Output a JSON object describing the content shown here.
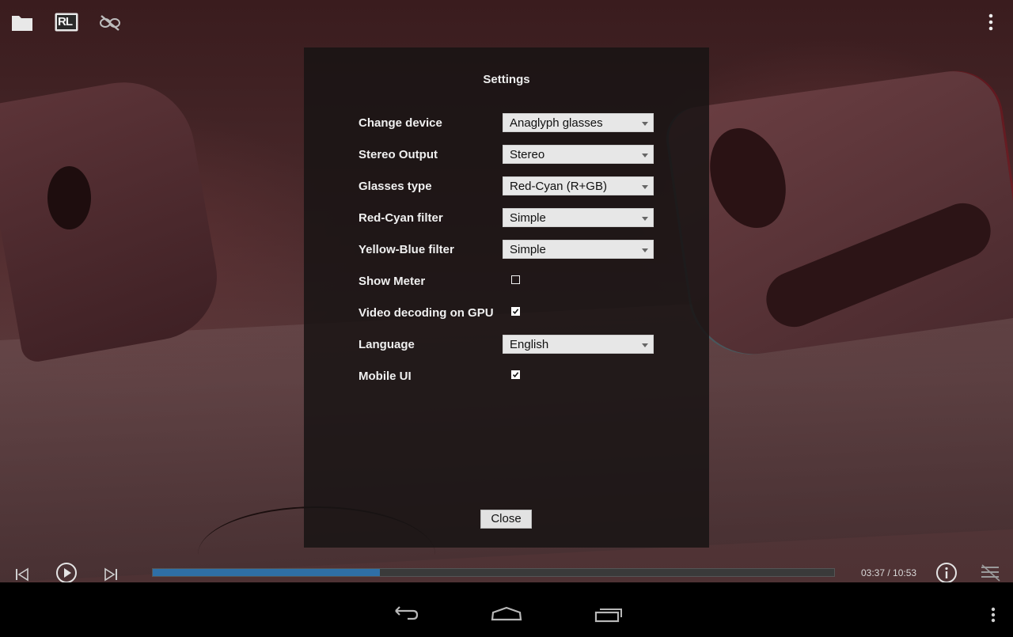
{
  "dialog": {
    "title": "Settings",
    "rows": [
      {
        "label": "Change device",
        "control": "select",
        "value": "Anaglyph glasses"
      },
      {
        "label": "Stereo Output",
        "control": "select",
        "value": "Stereo"
      },
      {
        "label": "Glasses type",
        "control": "select",
        "value": "Red-Cyan (R+GB)"
      },
      {
        "label": "Red-Cyan filter",
        "control": "select",
        "value": "Simple"
      },
      {
        "label": "Yellow-Blue filter",
        "control": "select",
        "value": "Simple"
      },
      {
        "label": "Show Meter",
        "control": "checkbox",
        "checked": false
      },
      {
        "label": "Video decoding on GPU",
        "control": "checkbox",
        "checked": true
      },
      {
        "label": "Language",
        "control": "select",
        "value": "English"
      },
      {
        "label": "Mobile UI",
        "control": "checkbox",
        "checked": true
      }
    ],
    "close_label": "Close"
  },
  "top_bar": {
    "icons": [
      "folder-icon",
      "rl-stereo-mode-icon",
      "glasses-off-icon",
      "overflow-menu-icon"
    ],
    "rl_badge_text": "RL"
  },
  "player": {
    "time": "03:37 / 10:53",
    "progress_fraction": 0.333,
    "icons": [
      "previous-icon",
      "play-icon",
      "next-icon",
      "info-icon",
      "playlist-icon"
    ]
  },
  "nav_bar": {
    "icons": [
      "back-icon",
      "home-icon",
      "recents-icon",
      "overflow-menu-icon"
    ]
  },
  "colors": {
    "seek_fill": "#2f6fa6",
    "dialog_bg": "#181414",
    "select_bg": "#e7e7e7"
  }
}
